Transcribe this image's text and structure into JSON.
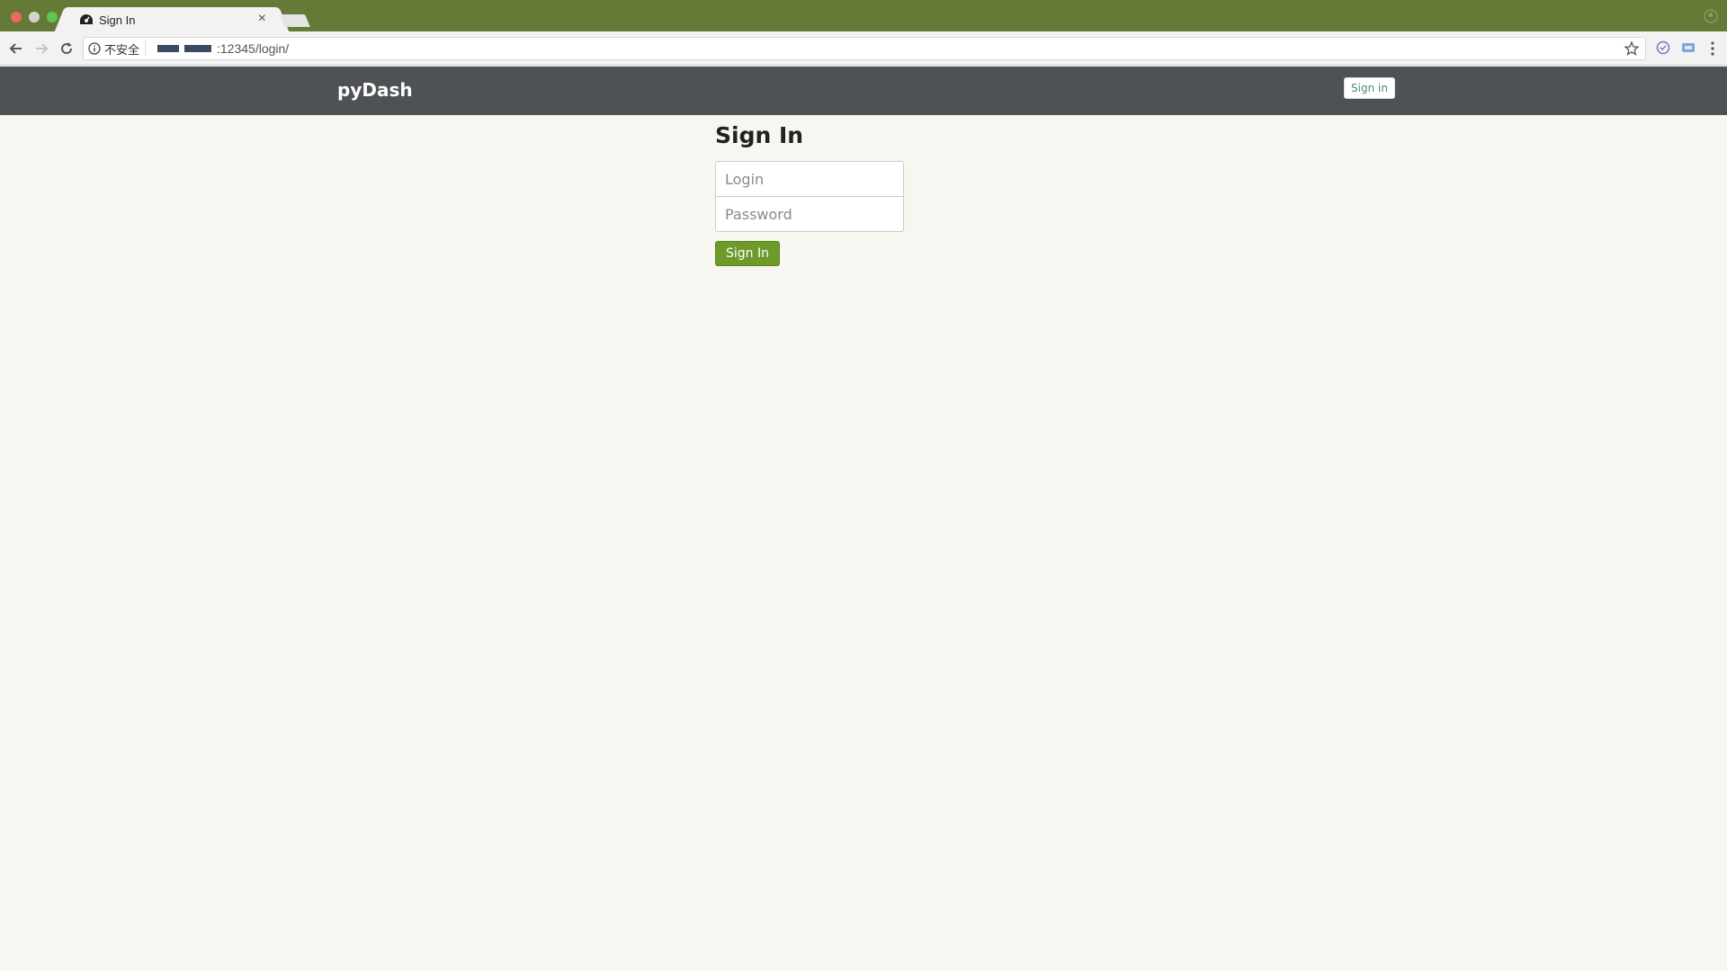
{
  "browser": {
    "tab_title": "Sign In",
    "tab_close": "×",
    "security_label": "不安全",
    "url_suffix": ":12345/login/"
  },
  "navbar": {
    "brand": "pyDash",
    "signin_label": "Sign in"
  },
  "form": {
    "title": "Sign In",
    "login_placeholder": "Login",
    "password_placeholder": "Password",
    "submit_label": "Sign In"
  },
  "colors": {
    "tabstrip": "#657a36",
    "navbar": "#4f5254",
    "submit": "#6e9a2a",
    "page_bg": "#f8f6f1"
  },
  "icons": {
    "tab_favicon": "dashboard-icon",
    "back": "arrow-left-icon",
    "forward": "arrow-right-icon",
    "reload": "reload-icon",
    "security": "info-icon",
    "bookmark": "star-icon",
    "menu": "kebab-menu-icon"
  }
}
